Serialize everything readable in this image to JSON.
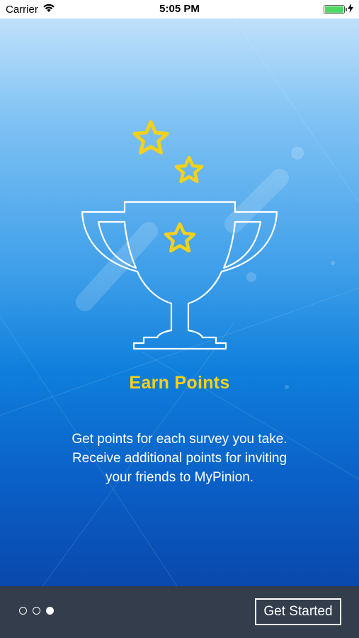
{
  "status_bar": {
    "carrier": "Carrier",
    "time": "5:05 PM",
    "icons": [
      "wifi-icon",
      "battery-icon",
      "charging-bolt-icon"
    ],
    "battery_level": 1.0
  },
  "onboarding": {
    "title": "Earn Points",
    "description_lines": [
      "Get points for each survey you take.",
      "Receive additional points for inviting",
      "your friends to MyPinion."
    ],
    "illustration_icons": [
      "trophy-icon",
      "star-icon",
      "star-icon",
      "star-icon"
    ]
  },
  "pager": {
    "total": 3,
    "active_index": 2
  },
  "actions": {
    "get_started_label": "Get Started"
  },
  "colors": {
    "accent_yellow": "#f4d11a",
    "bottom_bar": "#333d4c",
    "gradient_top": "#bfe0fa",
    "gradient_bottom": "#0a48ad"
  }
}
